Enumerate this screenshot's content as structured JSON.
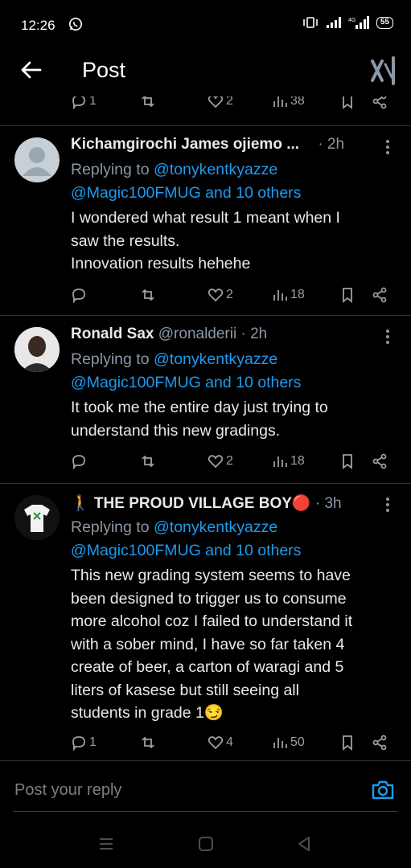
{
  "status_bar": {
    "time": "12:26",
    "battery": "55",
    "network": "4G"
  },
  "header": {
    "title": "Post"
  },
  "top_actions": {
    "replies": "1",
    "likes": "2",
    "views": "38"
  },
  "tweets": [
    {
      "name": "Kichamgirochi James ojiemo ...",
      "handle": "",
      "time": "· 2h",
      "replying_prefix": "Replying to ",
      "mention1": "@tonykentkyazze",
      "mention2": "@Magic100FMUG and 10 others",
      "body_lines": [
        "I wondered what result 1 meant when I",
        "saw the results.",
        "Innovation results hehehe"
      ],
      "replies": "",
      "likes": "2",
      "views": "18"
    },
    {
      "name": "Ronald Sax",
      "handle": "@ronalderii",
      "time": "· 2h",
      "replying_prefix": "Replying to ",
      "mention1": "@tonykentkyazze",
      "mention2": "@Magic100FMUG and 10 others",
      "body_lines": [
        "It took me  the entire day just trying to",
        "understand this new gradings."
      ],
      "replies": "",
      "likes": "2",
      "views": "18"
    },
    {
      "name": "🚶 THE PROUD VILLAGE BOY🔴",
      "handle": "",
      "time": "· 3h",
      "replying_prefix": "Replying to ",
      "mention1": "@tonykentkyazze",
      "mention2": "@Magic100FMUG and 10 others",
      "body_lines": [
        "This new grading system seems to have",
        "been designed to trigger us to consume",
        "more alcohol coz I failed to understand it",
        "with a sober mind, I have so far taken 4",
        "create of beer, a carton of waragi and 5",
        "liters of kasese but still seeing all",
        "students in grade 1😏"
      ],
      "replies": "1",
      "likes": "4",
      "views": "50"
    }
  ],
  "reply_box": {
    "placeholder": "Post your reply"
  },
  "colors": {
    "background": "#000000",
    "accent": "#1d9bf0",
    "secondary_text": "#8b98a5",
    "divider": "#2f3336"
  }
}
